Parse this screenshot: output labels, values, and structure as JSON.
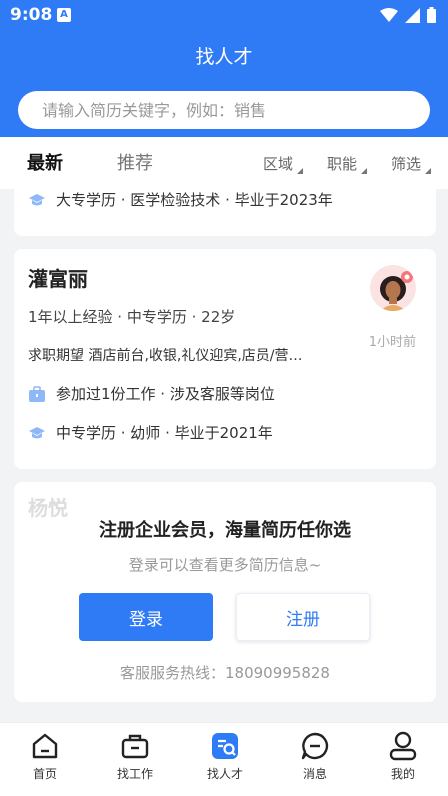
{
  "status_bar": {
    "time": "9:08",
    "notification_icon": "A"
  },
  "header": {
    "title": "找人才"
  },
  "search": {
    "placeholder": "请输入简历关键字，例如：销售"
  },
  "tabs": [
    {
      "label": "最新",
      "active": true
    },
    {
      "label": "推荐",
      "active": false
    }
  ],
  "filters": [
    {
      "label": "区域"
    },
    {
      "label": "职能"
    },
    {
      "label": "筛选"
    }
  ],
  "card_partial": {
    "education": "大专学历 · 医学检验技术 · 毕业于2023年"
  },
  "card": {
    "name": "灌富丽",
    "meta": "1年以上经验 · 中专学历 · 22岁",
    "expect": "求职期望 酒店前台,收银,礼仪迎宾,店员/营…",
    "time_ago": "1小时前",
    "work": "参加过1份工作 · 涉及客服等岗位",
    "education": "中专学历 · 幼师 · 毕业于2021年"
  },
  "overlay": {
    "ghost_name": "杨悦",
    "title": "注册企业会员，海量简历任你选",
    "subtitle": "登录可以查看更多简历信息~",
    "login_label": "登录",
    "register_label": "注册",
    "hotline": "客服服务热线：18090995828"
  },
  "bottom_nav": [
    {
      "label": "首页",
      "icon": "home-icon"
    },
    {
      "label": "找工作",
      "icon": "briefcase-icon"
    },
    {
      "label": "找人才",
      "icon": "find-talent-icon",
      "active": true
    },
    {
      "label": "消息",
      "icon": "message-icon"
    },
    {
      "label": "我的",
      "icon": "profile-icon"
    }
  ],
  "colors": {
    "accent": "#2f7bf6",
    "background": "#f2f3f5",
    "icon_blue": "#8fb8f8"
  }
}
